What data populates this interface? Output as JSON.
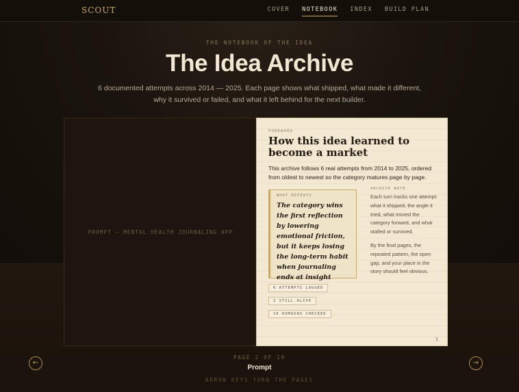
{
  "header": {
    "brand": "SCOUT",
    "nav": [
      "COVER",
      "NOTEBOOK",
      "INDEX",
      "BUILD PLAN"
    ],
    "active": "NOTEBOOK"
  },
  "hero": {
    "kicker": "THE NOTEBOOK OF THE IDEA",
    "title": "The Idea Archive",
    "subtitle": "6 documented attempts across 2014 — 2025. Each page shows what shipped, what made it different, why it survived or failed, and what it left behind for the next builder."
  },
  "book": {
    "left_caption": "PROMPT — MENTAL HEALTH JOURNALING APP",
    "foreword_kicker": "FOREWORD",
    "foreword_title": "How this idea learned to become a market",
    "foreword_lede": "This archive follows 6 real attempts from 2014 to 2025, ordered from oldest to newest so the category matures page by page.",
    "quote_kicker": "WHAT REPEATS",
    "quote_text": "The category wins the first reflection by lowering emotional friction, but it keeps losing the long-term habit when journaling ends at insight instea...",
    "note_kicker": "ARCHIVE NOTE",
    "note_p1": "Each turn tracks one attempt: what it shipped, the angle it tried, what moved the category forward, and what stalled or survived.",
    "note_p2": "By the final pages, the repeated pattern, the open gap, and your place in the story should feel obvious.",
    "tags": [
      "6 ATTEMPTS LOGGED",
      "2 STILL ALIVE",
      "10 DOMAINS CHECKED"
    ],
    "folio": "1"
  },
  "controls": {
    "prev_icon": "←",
    "next_icon": "→",
    "page_count": "PAGE 2 OF 19",
    "page_name": "Prompt",
    "hint": "ARROW KEYS TURN THE PAGES"
  },
  "colors": {
    "accent": "#c9a66b",
    "paper": "#f3e9d2",
    "background": "#16110c"
  }
}
